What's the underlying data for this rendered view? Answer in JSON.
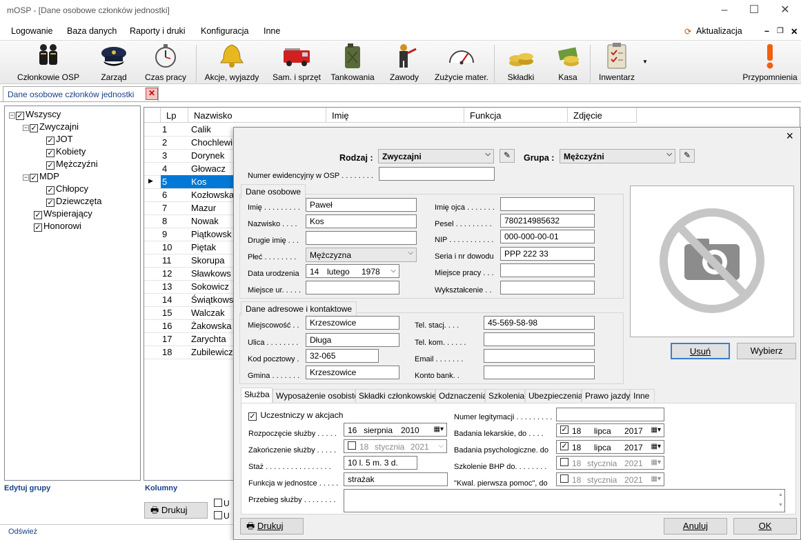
{
  "window": {
    "title": "mOSP - [Dane osobowe członków jednostki]"
  },
  "menu": [
    "Logowanie",
    "Baza danych",
    "Raporty i druki",
    "Konfiguracja",
    "Inne"
  ],
  "update_label": "Aktualizacja",
  "toolbar": [
    "Członkowie OSP",
    "Zarząd",
    "Czas pracy",
    "Akcje, wyjazdy",
    "Sam. i sprzęt",
    "Tankowania",
    "Zawody",
    "Zużycie mater.",
    "Składki",
    "Kasa",
    "Inwentarz",
    "Przypomnienia"
  ],
  "doc_tab": "Dane osobowe członków jednostki",
  "tree": [
    "Wszyscy",
    "Zwyczajni",
    "JOT",
    "Kobiety",
    "Mężczyźni",
    "MDP",
    "Chłopcy",
    "Dziewczęta",
    "Wspierający",
    "Honorowi"
  ],
  "grid": {
    "columns": [
      "Lp",
      "Nazwisko",
      "Imię",
      "Funkcja",
      "Zdjęcie"
    ],
    "rows": [
      {
        "lp": "1",
        "name": "Calik"
      },
      {
        "lp": "2",
        "name": "Chochlewi"
      },
      {
        "lp": "3",
        "name": "Dorynek"
      },
      {
        "lp": "4",
        "name": "Głowacz"
      },
      {
        "lp": "5",
        "name": "Kos"
      },
      {
        "lp": "6",
        "name": "Kozłowska"
      },
      {
        "lp": "7",
        "name": "Mazur"
      },
      {
        "lp": "8",
        "name": "Nowak"
      },
      {
        "lp": "9",
        "name": "Piątkowsk"
      },
      {
        "lp": "10",
        "name": "Piętak"
      },
      {
        "lp": "11",
        "name": "Skorupa"
      },
      {
        "lp": "12",
        "name": "Sławkows"
      },
      {
        "lp": "13",
        "name": "Sokowicz"
      },
      {
        "lp": "14",
        "name": "Świątkows"
      },
      {
        "lp": "15",
        "name": "Walczak"
      },
      {
        "lp": "16",
        "name": "Żakowska"
      },
      {
        "lp": "17",
        "name": "Zarychta"
      },
      {
        "lp": "18",
        "name": "Zubilewicz"
      }
    ]
  },
  "bottom": {
    "edit_groups": "Edytuj grupy",
    "columns": "Kolumny",
    "print": "Drukuj",
    "refresh": "Odśwież",
    "cb_u1": "U",
    "cb_u2": "U"
  },
  "dialog": {
    "close": "×",
    "rodzaj_label": "Rodzaj :",
    "rodzaj_value": "Zwyczajni",
    "grupa_label": "Grupa :",
    "grupa_value": "Mężczyźni",
    "numer_label": "Numer ewidencyjny w OSP . . . . . . . .",
    "numer_value": "",
    "personal": {
      "title": "Dane osobowe",
      "imie_label": "Imię . . . . . . . . .",
      "imie": "Paweł",
      "nazwisko_label": "Nazwisko . . . .",
      "nazwisko": "Kos",
      "drugie_label": "Drugie imię . . .",
      "drugie": "",
      "plec_label": "Płeć . . . . . . . .",
      "plec": "Mężczyzna",
      "data_label": "Data urodzenia",
      "data_day": "14",
      "data_month": "lutego",
      "data_year": "1978",
      "miejsce_label": "Miejsce ur. . . . .",
      "miejsce": "",
      "imie_ojca_label": "Imię ojca . . . . . . .",
      "imie_ojca": "",
      "pesel_label": "Pesel . . . . . . . . .",
      "pesel": "780214985632",
      "nip_label": "NIP . . . . . . . . . . .",
      "nip": "000-000-00-01",
      "seria_label": "Seria i nr dowodu",
      "seria": "PPP 222 33",
      "praca_label": "Miejsce pracy . . .",
      "praca": "",
      "wyksz_label": "Wykształcenie . .",
      "wyksz": ""
    },
    "address": {
      "title": "Dane adresowe i kontaktowe",
      "miejsc_label": "Miejscowość . .",
      "miejsc": "Krzeszowice",
      "ulica_label": "Ulica . . . . . . . .",
      "ulica": "Długa",
      "kod_label": "Kod pocztowy .",
      "kod": "32-065",
      "gmina_label": "Gmina . . . . . . .",
      "gmina": "Krzeszowice",
      "tel_label": "Tel. stacj. . . .",
      "tel": "45-569-58-98",
      "kom_label": "Tel. kom. . . . . .",
      "kom": "",
      "email_label": "Email . . . . . . .",
      "email": "",
      "konto_label": "Konto bank. .",
      "konto": ""
    },
    "photo": {
      "remove": "Usuń",
      "choose": "Wybierz"
    },
    "tabs": [
      "Służba",
      "Wyposażenie osobiste",
      "Składki członkowskie",
      "Odznaczenia",
      "Szkolenia",
      "Ubezpieczenia",
      "Prawo jazdy",
      "Inne"
    ],
    "service": {
      "uczest_label": "Uczestniczy w akcjach",
      "rozp_label": "Rozpoczęcie służby . . . . .",
      "rozp": {
        "d": "16",
        "m": "sierpnia",
        "y": "2010"
      },
      "zak_label": "Zakończenie służby . . . . .",
      "zak": {
        "d": "18",
        "m": "stycznia",
        "y": "2021"
      },
      "staz_label": "Staż . . . . . . . . . . . . . . . .",
      "staz": "10 l. 5 m. 3 d.",
      "funkcja_label": "Funkcja w jednostce . . . . .",
      "funkcja": "strażak",
      "przebieg_label": "Przebieg służby . . . . . . . .",
      "legit_label": "Numer legitymacji . . . . . . . . .",
      "legit": "",
      "lek_label": "Badania lekarskie, do . . . .",
      "lek": {
        "d": "18",
        "m": "lipca",
        "y": "2017"
      },
      "psych_label": "Badania psychologiczne. do",
      "psych": {
        "d": "18",
        "m": "lipca",
        "y": "2017"
      },
      "bhp_label": "Szkolenie BHP do. . . . . . . .",
      "bhp": {
        "d": "18",
        "m": "stycznia",
        "y": "2021"
      },
      "kwal_label": "\"Kwal. pierwsza pomoc\", do",
      "kwal": {
        "d": "18",
        "m": "stycznia",
        "y": "2021"
      }
    },
    "print": "Drukuj",
    "cancel": "Anuluj",
    "ok": "OK"
  }
}
